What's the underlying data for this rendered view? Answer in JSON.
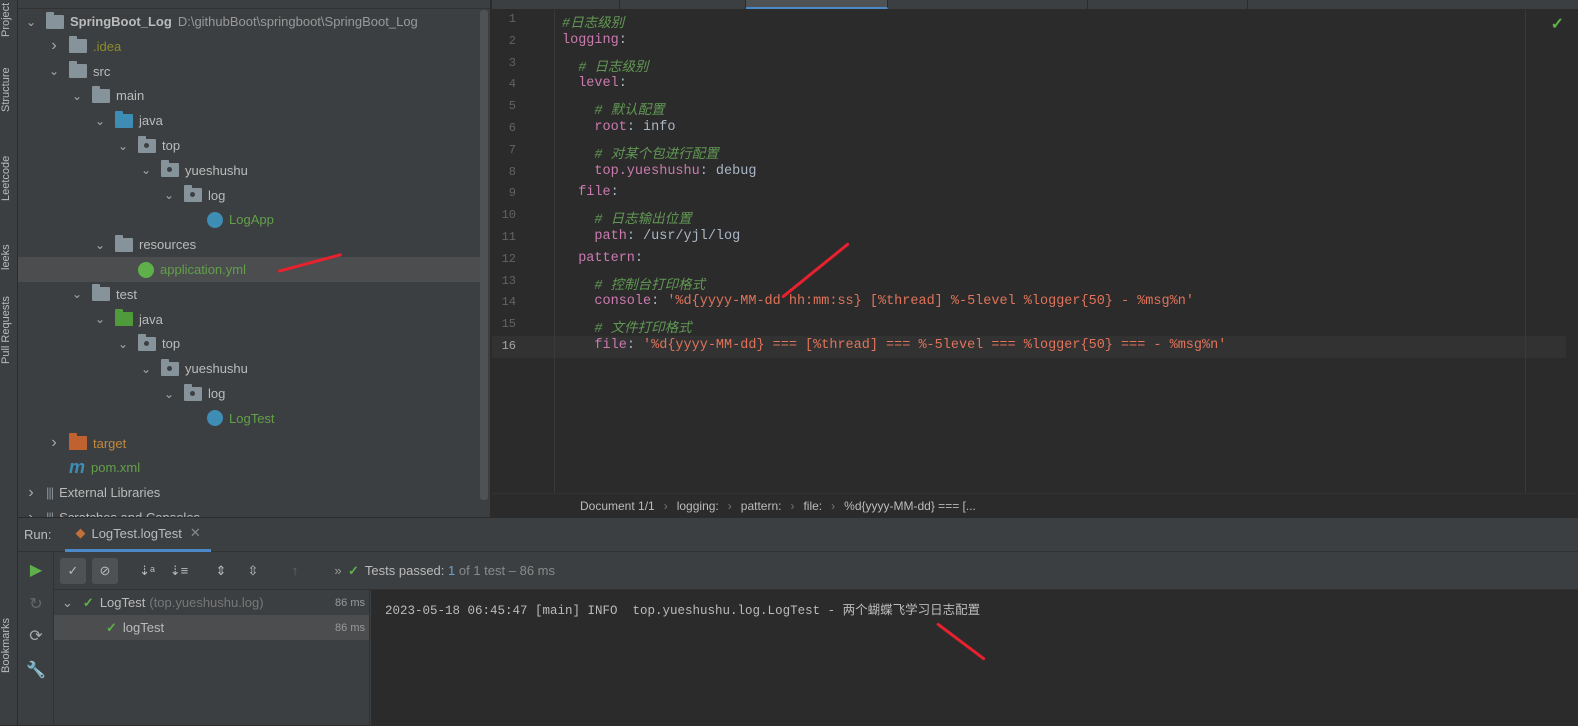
{
  "side_strip": {
    "labels": [
      "Project",
      "Structure",
      "Leetcode",
      "leeks",
      "Pull Requests",
      "Bookmarks"
    ]
  },
  "project_tree": [
    {
      "depth": 0,
      "chev": "down",
      "icon": "module",
      "label": "SpringBoot_Log",
      "bold": true,
      "path": "D:\\githubBoot\\springboot\\SpringBoot_Log"
    },
    {
      "depth": 1,
      "chev": "right",
      "icon": "folder",
      "label": ".idea",
      "color": "#8c8c2a"
    },
    {
      "depth": 1,
      "chev": "down",
      "icon": "folder",
      "label": "src"
    },
    {
      "depth": 2,
      "chev": "down",
      "icon": "folder",
      "label": "main"
    },
    {
      "depth": 3,
      "chev": "down",
      "icon": "source-folder",
      "label": "java"
    },
    {
      "depth": 4,
      "chev": "down",
      "icon": "package",
      "label": "top"
    },
    {
      "depth": 5,
      "chev": "down",
      "icon": "package",
      "label": "yueshushu"
    },
    {
      "depth": 6,
      "chev": "down",
      "icon": "package",
      "label": "log"
    },
    {
      "depth": 7,
      "chev": "none",
      "icon": "spring-class",
      "label": "LogApp",
      "color": "#62a04a"
    },
    {
      "depth": 3,
      "chev": "down",
      "icon": "resources-folder",
      "label": "resources"
    },
    {
      "depth": 4,
      "chev": "none",
      "icon": "spring-yml",
      "label": "application.yml",
      "color": "#62a04a",
      "selected": true
    },
    {
      "depth": 2,
      "chev": "down",
      "icon": "folder",
      "label": "test"
    },
    {
      "depth": 3,
      "chev": "down",
      "icon": "test-folder",
      "label": "java"
    },
    {
      "depth": 4,
      "chev": "down",
      "icon": "package",
      "label": "top"
    },
    {
      "depth": 5,
      "chev": "down",
      "icon": "package",
      "label": "yueshushu"
    },
    {
      "depth": 6,
      "chev": "down",
      "icon": "package",
      "label": "log"
    },
    {
      "depth": 7,
      "chev": "none",
      "icon": "test-class",
      "label": "LogTest",
      "color": "#62a04a"
    },
    {
      "depth": 1,
      "chev": "right",
      "icon": "excluded-folder",
      "label": "target",
      "color": "#c08a3e"
    },
    {
      "depth": 1,
      "chev": "none",
      "icon": "maven",
      "label": "pom.xml",
      "color": "#62a04a"
    },
    {
      "depth": 0,
      "chev": "right",
      "icon": "libraries",
      "label": "External Libraries"
    },
    {
      "depth": 0,
      "chev": "right",
      "icon": "scratches",
      "label": "Scratches and Consoles"
    }
  ],
  "editor": {
    "lines": [
      [
        [
          "c",
          "#日志级别"
        ]
      ],
      [
        [
          "k",
          "logging"
        ],
        [
          "p",
          ":"
        ]
      ],
      [
        [
          "p",
          "  "
        ],
        [
          "c",
          "# 日志级别"
        ]
      ],
      [
        [
          "p",
          "  "
        ],
        [
          "k",
          "level"
        ],
        [
          "p",
          ":"
        ]
      ],
      [
        [
          "p",
          "    "
        ],
        [
          "c",
          "# 默认配置"
        ]
      ],
      [
        [
          "p",
          "    "
        ],
        [
          "k",
          "root"
        ],
        [
          "p",
          ": info"
        ]
      ],
      [
        [
          "p",
          "    "
        ],
        [
          "c",
          "# 对某个包进行配置"
        ]
      ],
      [
        [
          "p",
          "    "
        ],
        [
          "k",
          "top.yueshushu"
        ],
        [
          "p",
          ": debug"
        ]
      ],
      [
        [
          "p",
          "  "
        ],
        [
          "k",
          "file"
        ],
        [
          "p",
          ":"
        ]
      ],
      [
        [
          "p",
          "    "
        ],
        [
          "c",
          "# 日志输出位置"
        ]
      ],
      [
        [
          "p",
          "    "
        ],
        [
          "k",
          "path"
        ],
        [
          "p",
          ": /usr/yjl/log"
        ]
      ],
      [
        [
          "p",
          "  "
        ],
        [
          "k",
          "pattern"
        ],
        [
          "p",
          ":"
        ]
      ],
      [
        [
          "p",
          "    "
        ],
        [
          "c",
          "# 控制台打印格式"
        ]
      ],
      [
        [
          "p",
          "    "
        ],
        [
          "k",
          "console"
        ],
        [
          "p",
          ": "
        ],
        [
          "s",
          "'%d{yyyy-MM-dd hh:mm:ss} [%thread] %-5level %logger{50} - %msg%n'"
        ]
      ],
      [
        [
          "p",
          "    "
        ],
        [
          "c",
          "# 文件打印格式"
        ]
      ],
      [
        [
          "p",
          "    "
        ],
        [
          "k",
          "file"
        ],
        [
          "p",
          ": "
        ],
        [
          "s",
          "'%d{yyyy-MM-dd} === [%thread] === %-5level === %logger{50} === - %msg%n'"
        ]
      ]
    ],
    "current_line": 16,
    "status_icon": "checkmark-icon",
    "breadcrumb": [
      "Document 1/1",
      "logging:",
      "pattern:",
      "file:",
      "%d{yyyy-MM-dd} === [..."
    ]
  },
  "run": {
    "label": "Run:",
    "tab": "LogTest.logTest",
    "status_prefix": "Tests passed:",
    "status_count": "1",
    "status_suffix": "of 1 test – 86 ms",
    "results": [
      {
        "name": "LogTest",
        "pkg": "(top.yueshushu.log)",
        "time": "86 ms",
        "depth": 0
      },
      {
        "name": "logTest",
        "pkg": "",
        "time": "86 ms",
        "depth": 1,
        "selected": true
      }
    ],
    "console": "2023-05-18 06:45:47 [main] INFO  top.yueshushu.log.LogTest - 两个蝴蝶飞学习日志配置"
  },
  "colors": {
    "accent": "#4a88c7",
    "pass": "#5fb04a",
    "annotation": "#e8212e"
  }
}
